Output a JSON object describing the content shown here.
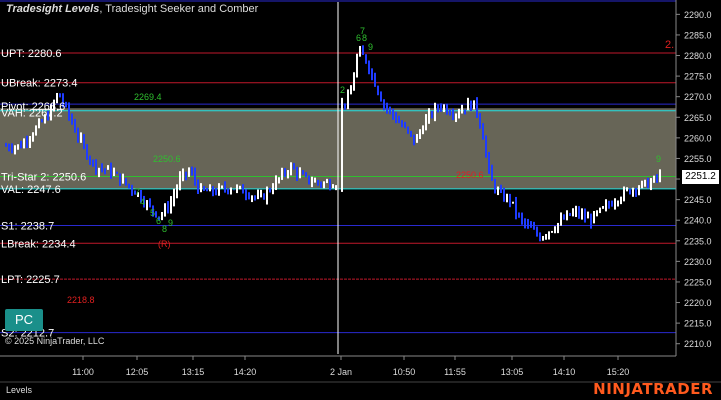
{
  "title": {
    "main": "Tradesight Levels",
    "sub": ", Tradesight Seeker and Comber"
  },
  "copyright": "© 2025 NinjaTrader, LLC",
  "bottom_label": "Levels",
  "logo": "NINJATRADER",
  "badge": "PC",
  "current_price": "2251.2",
  "colors": {
    "red_level": "#c0182b",
    "blue_level": "#2a2ad0",
    "cyan_level": "#22e0e0",
    "value_area": "#6d6a5c",
    "up_bar": "#ffffff",
    "down_bar": "#1f3cff",
    "green_text": "#2fbf2f",
    "red_text": "#e02020"
  },
  "chart_data": {
    "type": "bar",
    "y_ticks": [
      2290.0,
      2285.0,
      2280.0,
      2275.0,
      2270.0,
      2265.0,
      2260.0,
      2255.0,
      2250.0,
      2245.0,
      2240.0,
      2235.0,
      2230.0,
      2225.0,
      2220.0,
      2215.0,
      2210.0
    ],
    "x_ticks": [
      "11:00",
      "12:05",
      "13:15",
      "14:20",
      "2 Jan",
      "10:50",
      "11:55",
      "13:05",
      "14:10",
      "15:20"
    ],
    "ylim": [
      2207.5,
      2293.0
    ],
    "value_area": [
      2247.6,
      2267.2
    ],
    "levels": [
      {
        "label": "UPT: 2280.6",
        "price": 2280.6,
        "color": "#c0182b"
      },
      {
        "label": "UBreak: 2273.4",
        "price": 2273.4,
        "color": "#c0182b"
      },
      {
        "label": "Pivot: 2268.6",
        "price": 2268.2,
        "color": "#2a2ad0"
      },
      {
        "label": "VAH: 2267.2",
        "price": 2266.6,
        "color": "#22e0e0"
      },
      {
        "label": "Tri-Star 2: 2250.6",
        "price": 2250.6,
        "color": "#2fbf2f"
      },
      {
        "label": "VAL: 2247.6",
        "price": 2247.6,
        "color": "#22e0e0"
      },
      {
        "label": "S1: 2238.7",
        "price": 2238.7,
        "color": "#2a2ad0"
      },
      {
        "label": "LBreak: 2234.4",
        "price": 2234.4,
        "color": "#c0182b"
      },
      {
        "label": "LPT: 2225.7",
        "price": 2225.7,
        "color": "#c0182b"
      },
      {
        "label": "S2: 2212.7",
        "price": 2212.7,
        "color": "#2a2ad0"
      }
    ],
    "annotations": [
      {
        "text": "2269.4",
        "price": 2269.4,
        "color": "#2fbf2f"
      },
      {
        "text": "2250.6",
        "price": 2250.6,
        "color": "#2fbf2f"
      },
      {
        "text": "2250.6",
        "price": 2250.6,
        "color": "#e02020"
      },
      {
        "text": "2218.8",
        "price": 2218.8,
        "color": "#e02020"
      },
      {
        "text": "2.",
        "price": 2280.6,
        "color": "#e02020"
      },
      {
        "text": "(R)",
        "price": 2236.0,
        "color": "#e02020"
      }
    ]
  }
}
